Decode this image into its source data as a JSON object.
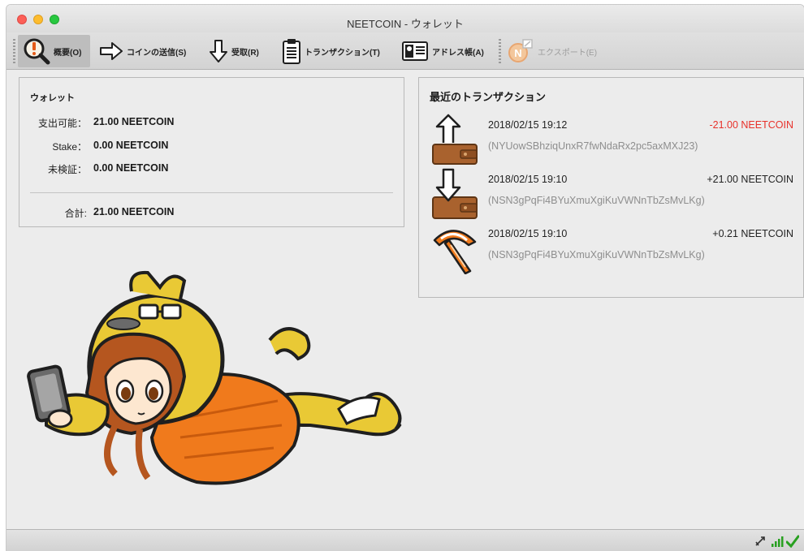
{
  "window": {
    "title": "NEETCOIN - ウォレット"
  },
  "toolbar": {
    "overview": "概要(O)",
    "send": "コインの送信(S)",
    "receive": "受取(R)",
    "transactions": "トランザクション(T)",
    "address_book": "アドレス帳(A)",
    "export": "エクスポート(E)"
  },
  "wallet": {
    "heading": "ウォレット",
    "rows": [
      {
        "label": "支出可能：",
        "value": "21.00 NEETCOIN"
      },
      {
        "label": "Stake：",
        "value": "0.00 NEETCOIN"
      },
      {
        "label": "未検証：",
        "value": "0.00 NEETCOIN"
      }
    ],
    "total": {
      "label": "合計:",
      "value": "21.00 NEETCOIN"
    }
  },
  "recent": {
    "heading": "最近のトランザクション",
    "items": [
      {
        "type": "sent",
        "icon": "send-wallet-icon",
        "date": "2018/02/15 19:12",
        "amount": "-21.00 NEETCOIN",
        "address": "(NYUowSBhziqUnxR7fwNdaRx2pc5axMXJ23)",
        "amount_color": "#e8312a"
      },
      {
        "type": "received",
        "icon": "receive-wallet-icon",
        "date": "2018/02/15 19:10",
        "amount": "+21.00 NEETCOIN",
        "address": "(NSN3gPqFi4BYuXmuXgiKuVWNnTbZsMvLKg)",
        "amount_color": "#222222"
      },
      {
        "type": "mined",
        "icon": "pickaxe-icon",
        "date": "2018/02/15 19:10",
        "amount": "+0.21 NEETCOIN",
        "address": "(NSN3gPqFi4BYuXmuXgiKuVWNnTbZsMvLKg)",
        "amount_color": "#222222"
      }
    ]
  },
  "status": {
    "icons": [
      "staking-icon",
      "signal-bars-icon",
      "synced-check-icon"
    ]
  },
  "colors": {
    "negative": "#e8312a",
    "accent_orange": "#f07a1c",
    "wallet_brown": "#a9622e",
    "mascot_yellow": "#e9c935"
  }
}
